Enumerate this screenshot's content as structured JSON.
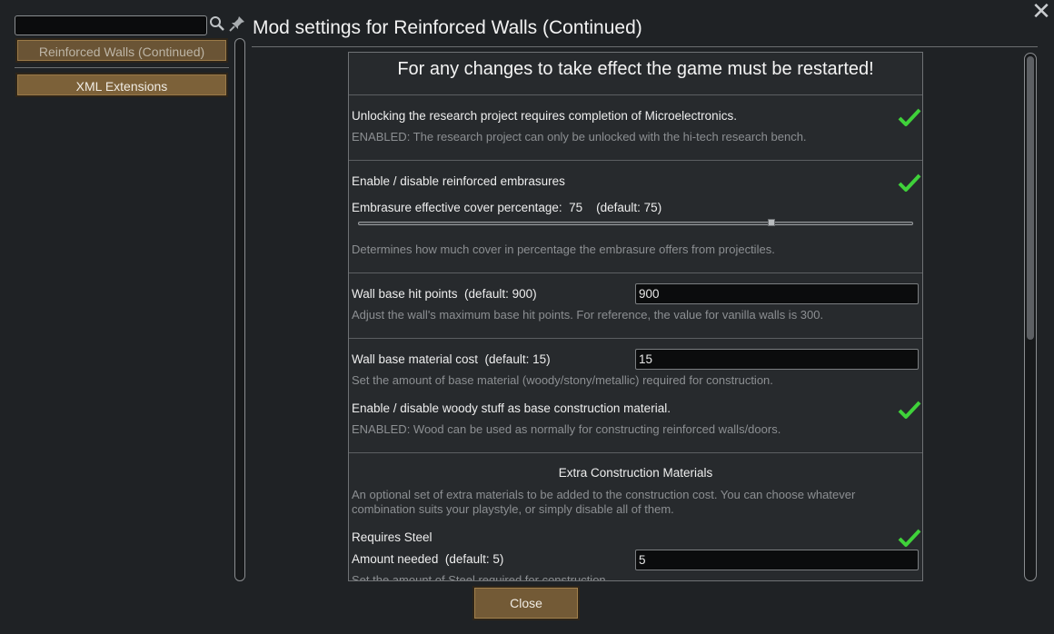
{
  "sidebar": {
    "search": {
      "value": "",
      "placeholder": ""
    },
    "search_icon": "magnifier-icon",
    "pin_icon": "pin-icon",
    "mods": [
      {
        "label": "Reinforced Walls (Continued)",
        "selected": true
      },
      {
        "label": "XML Extensions",
        "selected": false
      }
    ]
  },
  "header": {
    "title": "Mod settings for Reinforced Walls (Continued)",
    "close_glyph": "✕"
  },
  "settings": {
    "warning": "For any changes to take effect the game must be restarted!",
    "research": {
      "label": "Unlocking the research project requires completion of Microelectronics.",
      "description": "ENABLED: The research project can only be unlocked with the hi-tech research bench.",
      "checked": true
    },
    "embrasures": {
      "label": "Enable / disable reinforced embrasures",
      "checked": true,
      "cover_label": "Embrasure effective cover percentage:  75    (default: 75)",
      "cover_value": 75,
      "cover_range": [
        0,
        100
      ],
      "description": "Determines how much cover in percentage the embrasure offers from projectiles."
    },
    "hit_points": {
      "label": "Wall base hit points  (default: 900)",
      "value": "900",
      "description": "Adjust the wall's maximum base hit points. For reference, the value for vanilla walls is 300."
    },
    "material_cost": {
      "label": "Wall base material cost  (default: 15)",
      "value": "15",
      "description": "Set the amount of base material (woody/stony/metallic) required for construction."
    },
    "woody": {
      "label": "Enable / disable woody stuff as base construction material.",
      "description": "ENABLED: Wood can be used as normally for constructing reinforced walls/doors.",
      "checked": true
    },
    "extra": {
      "heading": "Extra Construction Materials",
      "description_line1": "An optional set of extra materials to be added to the construction cost. You can choose whatever",
      "description_line2": "combination suits your playstyle, or simply disable all of them."
    },
    "steel": {
      "label": "Requires Steel",
      "checked": true,
      "amount_label": "Amount needed  (default: 5)",
      "amount_value": "5",
      "description": "Set the amount of Steel required for construction."
    }
  },
  "footer": {
    "close_label": "Close"
  },
  "colors": {
    "check": "#3fd13a",
    "button_brown": "#735a36",
    "background": "#1f2225"
  }
}
